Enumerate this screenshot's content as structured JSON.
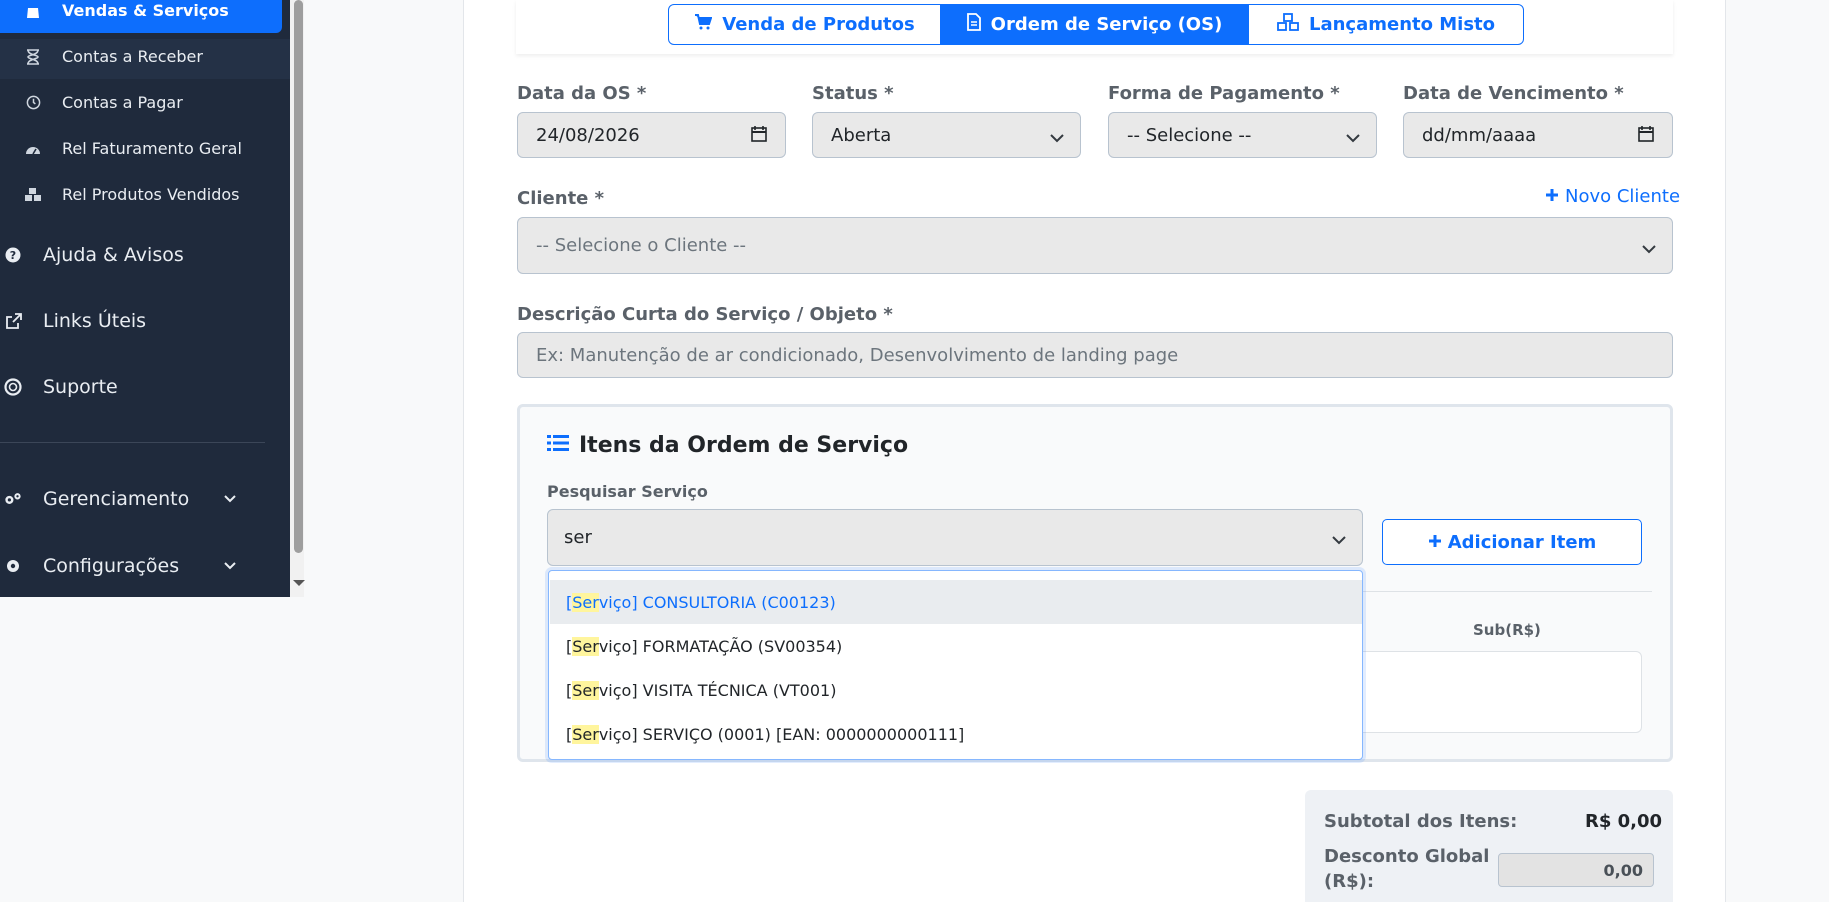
{
  "sidebar": {
    "items": [
      {
        "label": "Vendas & Serviços",
        "icon": "bag-icon"
      },
      {
        "label": "Contas a Receber",
        "icon": "hourglass-icon"
      },
      {
        "label": "Contas a Pagar",
        "icon": "clock-icon"
      },
      {
        "label": "Rel Faturamento Geral",
        "icon": "gauge-icon"
      },
      {
        "label": "Rel Produtos Vendidos",
        "icon": "cubes-icon"
      }
    ],
    "top_items": [
      {
        "label": "Ajuda & Avisos",
        "icon": "question-icon"
      },
      {
        "label": "Links Úteis",
        "icon": "external-link-icon"
      },
      {
        "label": "Suporte",
        "icon": "lifebuoy-icon"
      },
      {
        "label": "Gerenciamento",
        "icon": "gears-icon"
      },
      {
        "label": "Configurações",
        "icon": "gear-icon"
      }
    ]
  },
  "tabs": {
    "venda": "Venda de Produtos",
    "os": "Ordem de Serviço (OS)",
    "misto": "Lançamento Misto"
  },
  "form": {
    "data_os_label": "Data da OS *",
    "data_os_value": "24/08/2026",
    "status_label": "Status *",
    "status_value": "Aberta",
    "pagamento_label": "Forma de Pagamento *",
    "pagamento_value": "-- Selecione --",
    "vencimento_label": "Data de Vencimento *",
    "vencimento_value": "dd/mm/aaaa",
    "cliente_label": "Cliente *",
    "novo_cliente": "Novo Cliente",
    "cliente_value": "-- Selecione o Cliente --",
    "descricao_label": "Descrição Curta do Serviço / Objeto *",
    "descricao_placeholder": "Ex: Manutenção de ar condicionado, Desenvolvimento de landing page"
  },
  "itens": {
    "title": "Itens da Ordem de Serviço",
    "search_label": "Pesquisar Serviço",
    "search_value": "ser",
    "add_button": "Adicionar Item",
    "sub_header": "Sub(R$)",
    "options": [
      {
        "prefix": "[",
        "match": "Ser",
        "rest": "viço] CONSULTORIA (C00123)"
      },
      {
        "prefix": "[",
        "match": "Ser",
        "rest": "viço] FORMATAÇÃO (SV00354)"
      },
      {
        "prefix": "[",
        "match": "Ser",
        "rest": "viço] VISITA TÉCNICA (VT001)"
      },
      {
        "prefix": "[",
        "match": "Ser",
        "rest": "viço] SERVIÇO (0001) [EAN: 0000000000111]"
      }
    ]
  },
  "totals": {
    "subtotal_label": "Subtotal dos Itens:",
    "subtotal_value": "R$ 0,00",
    "desconto_label_1": "Desconto Global",
    "desconto_label_2": "(R$):",
    "desconto_value": "0,00"
  },
  "colors": {
    "primary": "#0d6efd",
    "sidebar": "#1f2a3c"
  }
}
